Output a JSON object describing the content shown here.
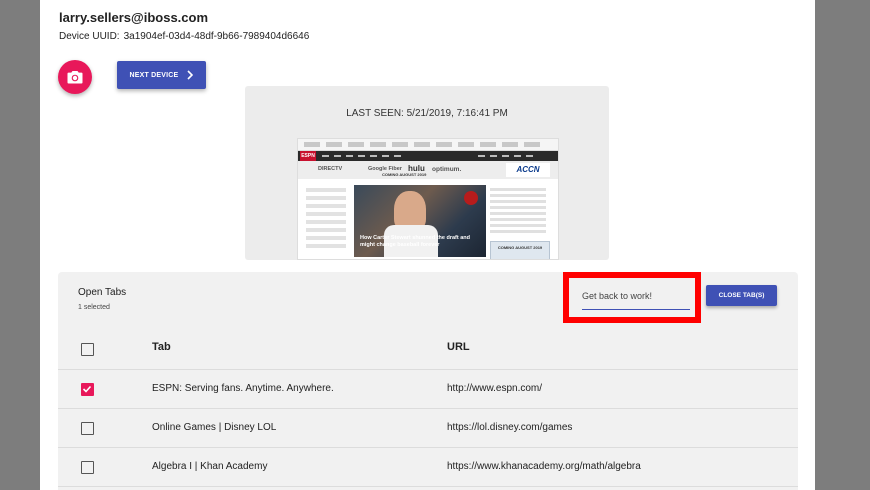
{
  "device": {
    "email": "larry.sellers@iboss.com",
    "uuid_label": "Device UUID:",
    "uuid_value": "3a1904ef-03d4-48df-9b66-7989404d6646"
  },
  "actions": {
    "camera_icon": "camera-icon",
    "next_device_label": "NEXT DEVICE",
    "next_icon": "chevron-right-icon"
  },
  "preview": {
    "last_seen": "LAST SEEN: 5/21/2019, 7:16:41 PM",
    "thumb_logo": "ESPN",
    "thumb_ad_1": "DIRECTV",
    "thumb_ad_2": "Google Fiber",
    "thumb_ad_3": "hulu",
    "thumb_ad_4": "optimum.",
    "thumb_accn": "ACCN",
    "thumb_coming": "COMING AUGUST 2019",
    "thumb_headline": "How Carter Stewart shunned the draft and might change baseball forever",
    "thumb_box": "COMING AUGUST 2019"
  },
  "open_tabs": {
    "title": "Open Tabs",
    "selected": "1 selected",
    "message_value": "Get back to work!",
    "close_label": "CLOSE TAB(S)",
    "columns": {
      "tab": "Tab",
      "url": "URL"
    },
    "rows": [
      {
        "tab": "ESPN: Serving fans. Anytime. Anywhere.",
        "url": "http://www.espn.com/",
        "checked": true
      },
      {
        "tab": "Online Games | Disney LOL",
        "url": "https://lol.disney.com/games",
        "checked": false
      },
      {
        "tab": "Algebra I | Khan Academy",
        "url": "https://www.khanacademy.org/math/algebra",
        "checked": false
      }
    ]
  },
  "colors": {
    "accent": "#3f51b5",
    "pink": "#e8185a",
    "highlight": "#ff0000"
  }
}
